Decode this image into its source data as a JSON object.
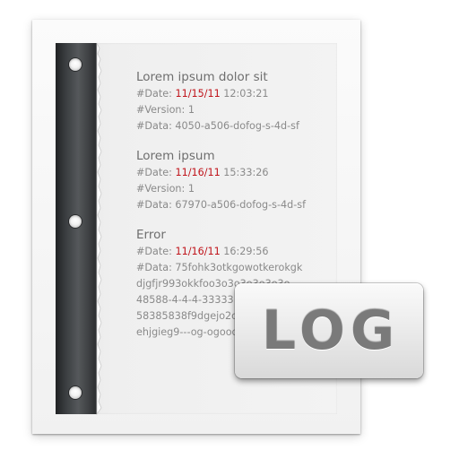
{
  "log": {
    "entries": [
      {
        "title": "Lorem ipsum dolor sit",
        "date_prefix": "#Date: ",
        "date": "11/15/11",
        "time": " 12:03:21",
        "version": "#Version: 1",
        "data": "#Data: 4050-a506-dofog-s-4d-sf"
      },
      {
        "title": "Lorem ipsum",
        "date_prefix": "#Date: ",
        "date": "11/16/11",
        "time": " 15:33:26",
        "version": "#Version: 1",
        "data": "#Data: 67970-a506-dofog-s-4d-sf"
      },
      {
        "title": "Error",
        "date_prefix": "#Date: ",
        "date": "11/16/11",
        "time": " 16:29:56",
        "data": "#Data: 75fohk3otkgowotkerokgk",
        "extra_lines": [
          "djgfjr993okkfoo3o3o3o3o3o3o",
          "48588-4-4-4-33333",
          "58385838f9dgejo2o3",
          "ehjgieg9---og-ogooo"
        ]
      }
    ]
  },
  "badge": {
    "label": "LOG"
  },
  "colors": {
    "date": "#c0141b",
    "text": "#8a8a8a",
    "title": "#6e6e6e"
  }
}
